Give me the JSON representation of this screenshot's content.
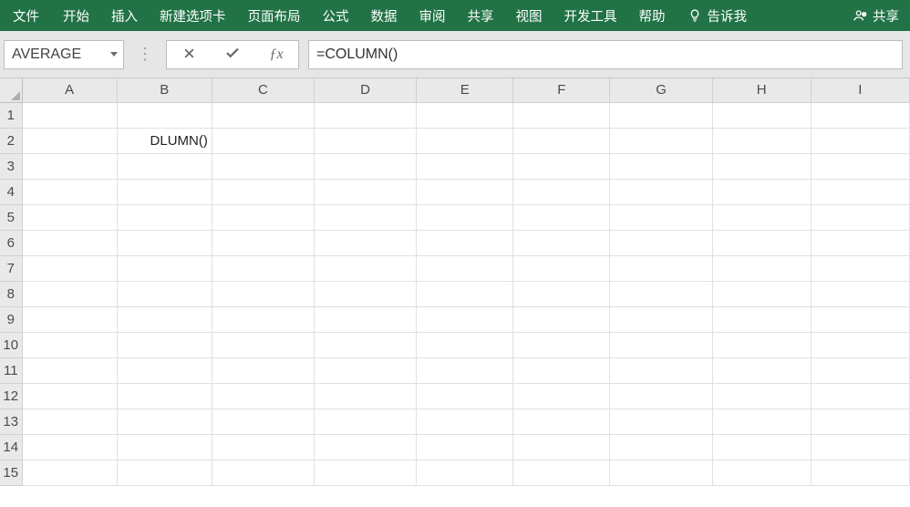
{
  "menu": {
    "file": "文件",
    "items": [
      "开始",
      "插入",
      "新建选项卡",
      "页面布局",
      "公式",
      "数据",
      "审阅",
      "共享",
      "视图",
      "开发工具",
      "帮助"
    ],
    "tell_me": "告诉我",
    "share": "共享"
  },
  "formula_bar": {
    "name_box": "AVERAGE",
    "formula": "=COLUMN()"
  },
  "grid": {
    "columns": [
      "A",
      "B",
      "C",
      "D",
      "E",
      "F",
      "G",
      "H",
      "I"
    ],
    "rows": [
      "1",
      "2",
      "3",
      "4",
      "5",
      "6",
      "7",
      "8",
      "9",
      "10",
      "11",
      "12",
      "13",
      "14",
      "15"
    ],
    "active_cell": "B2",
    "cells": {
      "B2": "DLUMN()"
    }
  }
}
